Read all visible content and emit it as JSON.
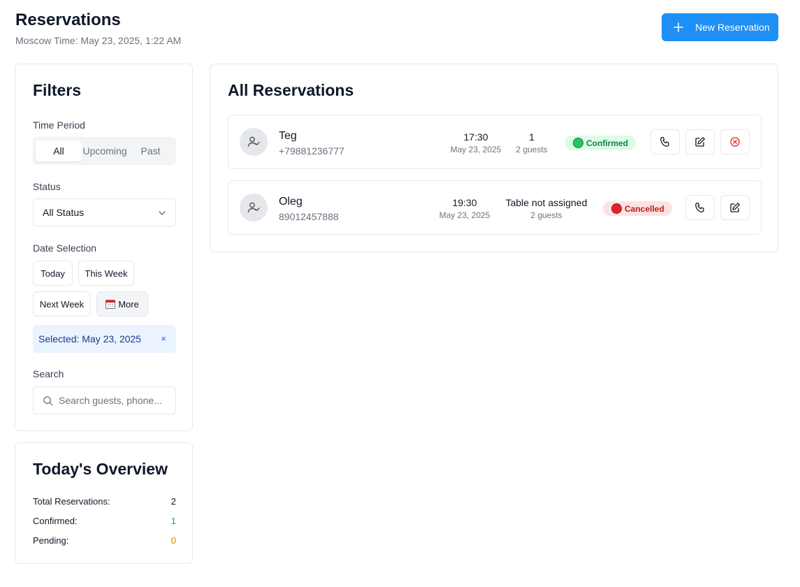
{
  "header": {
    "title": "Reservations",
    "subtitle": "Moscow Time: May 23, 2025, 1:22 AM",
    "new_button_label": "New Reservation"
  },
  "filters": {
    "title": "Filters",
    "time_period": {
      "label": "Time Period",
      "options": [
        "All",
        "Upcoming",
        "Past"
      ],
      "selected": "All"
    },
    "status": {
      "label": "Status",
      "selected": "All Status"
    },
    "date_selection": {
      "label": "Date Selection",
      "buttons": [
        "Today",
        "This Week",
        "Next Week",
        "More"
      ],
      "selected_text": "Selected: May 23, 2025",
      "clear_label": "×"
    },
    "search": {
      "label": "Search",
      "placeholder": "Search guests, phone...",
      "value": ""
    }
  },
  "overview": {
    "title": "Today's Overview",
    "rows": [
      {
        "label": "Total Reservations:",
        "value": "2"
      },
      {
        "label": "Confirmed:",
        "value": "1"
      },
      {
        "label": "Pending:",
        "value": "0"
      }
    ]
  },
  "reservations_panel": {
    "title": "All Reservations",
    "items": [
      {
        "name": "Teg",
        "phone": "+79881236777",
        "time": "17:30",
        "date": "May 23, 2025",
        "table": "1",
        "guests": "2 guests",
        "status": "Confirmed"
      },
      {
        "name": "Oleg",
        "phone": "89012457888",
        "time": "19:30",
        "date": "May 23, 2025",
        "table": "Table not assigned",
        "guests": "2 guests",
        "status": "Cancelled"
      }
    ]
  },
  "colors": {
    "accent": "#1e90f5",
    "confirmed": "#22c55e",
    "cancelled": "#dc2626",
    "pending": "#ca8a04"
  },
  "icons": [
    "plus-icon",
    "chevron-down-icon",
    "calendar-icon",
    "search-icon",
    "user-check-icon",
    "phone-icon",
    "edit-icon",
    "cancel-circle-icon"
  ]
}
